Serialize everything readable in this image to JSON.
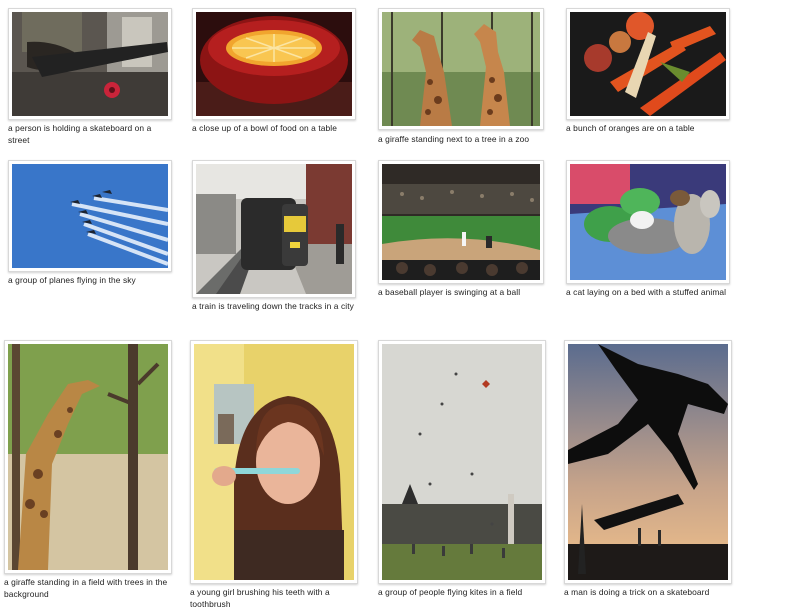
{
  "gallery": {
    "items": [
      {
        "caption": "a person is holding a skateboard on a street",
        "image": "person-skateboard-street"
      },
      {
        "caption": "a close up of a bowl of food on a table",
        "image": "orange-in-red-bowl"
      },
      {
        "caption": "a giraffe standing next to a tree in a zoo",
        "image": "two-giraffes-zoo"
      },
      {
        "caption": "a bunch of oranges are on a table",
        "image": "vegetables-on-table"
      },
      {
        "caption": "a group of planes flying in the sky",
        "image": "jets-formation-sky"
      },
      {
        "caption": "a train is traveling down the tracks in a city",
        "image": "train-on-tracks"
      },
      {
        "caption": "a baseball player is swinging at a ball",
        "image": "baseball-stadium"
      },
      {
        "caption": "a cat laying on a bed with a stuffed animal",
        "image": "cat-with-stuffed-animals"
      },
      {
        "caption": "a giraffe standing in a field with trees in the background",
        "image": "giraffe-in-field"
      },
      {
        "caption": "a young girl brushing his teeth with a toothbrush",
        "image": "girl-brushing-teeth"
      },
      {
        "caption": "a group of people flying kites in a field",
        "image": "kites-over-park"
      },
      {
        "caption": "a man is doing a trick on a skateboard",
        "image": "skateboarder-silhouette"
      }
    ]
  }
}
